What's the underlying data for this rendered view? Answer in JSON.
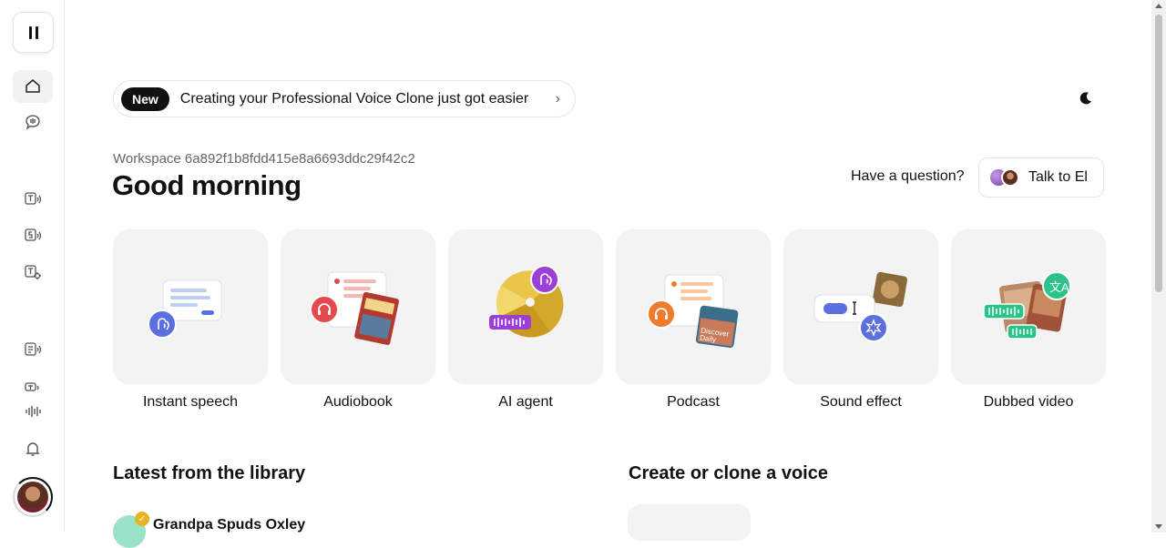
{
  "sidebar": {
    "items": [
      {
        "icon": "home-icon",
        "active": true
      },
      {
        "icon": "speech-bubble-icon"
      },
      {
        "icon": "text-to-speech-icon"
      },
      {
        "icon": "speech-to-speech-icon"
      },
      {
        "icon": "sound-settings-icon"
      },
      {
        "icon": "document-audio-icon"
      },
      {
        "icon": "translate-icon"
      },
      {
        "icon": "waveform-icon"
      },
      {
        "icon": "bell-icon"
      }
    ],
    "avatar": "user-avatar"
  },
  "banner": {
    "badge": "New",
    "text": "Creating your Professional Voice Clone just got easier",
    "chevron": "›"
  },
  "header": {
    "workspace": "Workspace 6a892f1b8fdd415e8a6693ddc29f42c2",
    "greeting": "Good morning",
    "question": "Have a question?",
    "talk_button": "Talk to El"
  },
  "cards": [
    {
      "label": "Instant speech",
      "icon": "instant-speech-illustration"
    },
    {
      "label": "Audiobook",
      "icon": "audiobook-illustration"
    },
    {
      "label": "AI agent",
      "icon": "ai-agent-illustration"
    },
    {
      "label": "Podcast",
      "icon": "podcast-illustration"
    },
    {
      "label": "Sound effect",
      "icon": "sound-effect-illustration"
    },
    {
      "label": "Dubbed video",
      "icon": "dubbed-video-illustration"
    }
  ],
  "library": {
    "title": "Latest from the library",
    "items": [
      {
        "name": "Grandpa Spuds Oxley"
      }
    ]
  },
  "clone": {
    "title": "Create or clone a voice"
  },
  "colors": {
    "accent_blue": "#5b6fe0",
    "accent_red": "#e5484d",
    "accent_purple": "#9b3fd6",
    "accent_orange": "#f07b2d",
    "accent_green": "#2bc38a",
    "tile_bg": "#f3f3f3"
  }
}
